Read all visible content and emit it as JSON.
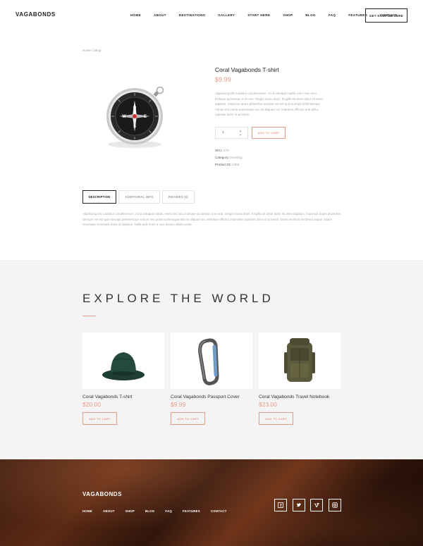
{
  "header": {
    "logo": "VAGABONDS",
    "nav": [
      "HOME",
      "ABOUT",
      "DESTINATIONS",
      "GALLERY",
      "START HERE",
      "SHOP",
      "BLOG",
      "FAQ",
      "FEATURES",
      "CONTACT"
    ],
    "cta": "GET STARTED HERE"
  },
  "breadcrumb": "Home / Shop",
  "product": {
    "title": "Coral Vagabonds T-shirt",
    "price": "$9.99",
    "description": "Adipiscing elit curabitur condimentum, mi id volutpat mattis, enim nec arcu tristique accumsan a et erat. Integer lacus diam, fringilla sit amet dolor sit amet dapibus, maximus turpis phasellus Semper vel est quis suscipit pellentesque rutrum nec porta scelerisque nisi mi aliquam ex, interdum efficitur erat tellus egestas dolor ut at lorem.",
    "quantity": "1",
    "add_to_cart": "ADD TO CART",
    "meta": {
      "sku_label": "SKU:",
      "sku": "678",
      "category_label": "Category:",
      "category": "traveling",
      "product_id_label": "Product ID:",
      "product_id": "2356"
    }
  },
  "tabs": [
    "DESCRIPTION",
    "ADDITIONAL INFO",
    "REVIEWS (0)"
  ],
  "tab_content": "Adipiscing elit curabitur condimentum, mi id volutpat mattis, enim nec arcu tristique accumsan a et erat. Integer lacus diam, fringilla sit amet dolor sit amet dapibus, maximus turpis phasellus Semper vel est quis suscipit pellentesque rutrum nec porta scelerisque nisi mi aliquam ex, interdum efficitur erat tellus egestas dolor ut at lorem. lorem morbi in hendrerit augue. Etiam venenatis venenatis dolor id dapibus. Nulla quis enim a mus dictum ullamcorper.",
  "explore": {
    "title": "EXPLORE THE WORLD",
    "cards": [
      {
        "name": "Coral Vagabonds T-shirt",
        "price": "$20.00",
        "button": "ADD TO CART"
      },
      {
        "name": "Coral Vagabonds Passport Cover",
        "price": "$9.99",
        "button": "ADD TO CART"
      },
      {
        "name": "Coral Vagabonds Travel Notebook",
        "price": "$23.00",
        "button": "ADD TO CART"
      }
    ]
  },
  "footer": {
    "logo": "VAGABONDS",
    "nav": [
      "HOME",
      "ABOUT",
      "SHOP",
      "BLOG",
      "FAQ",
      "FEATURES",
      "CONTACT"
    ],
    "social": [
      "facebook-icon",
      "twitter-icon",
      "vimeo-icon",
      "instagram-icon"
    ]
  },
  "colors": {
    "accent": "#e69b87",
    "text_dark": "#222222",
    "muted": "#aaaaaa",
    "section_bg": "#f4f4f4"
  }
}
